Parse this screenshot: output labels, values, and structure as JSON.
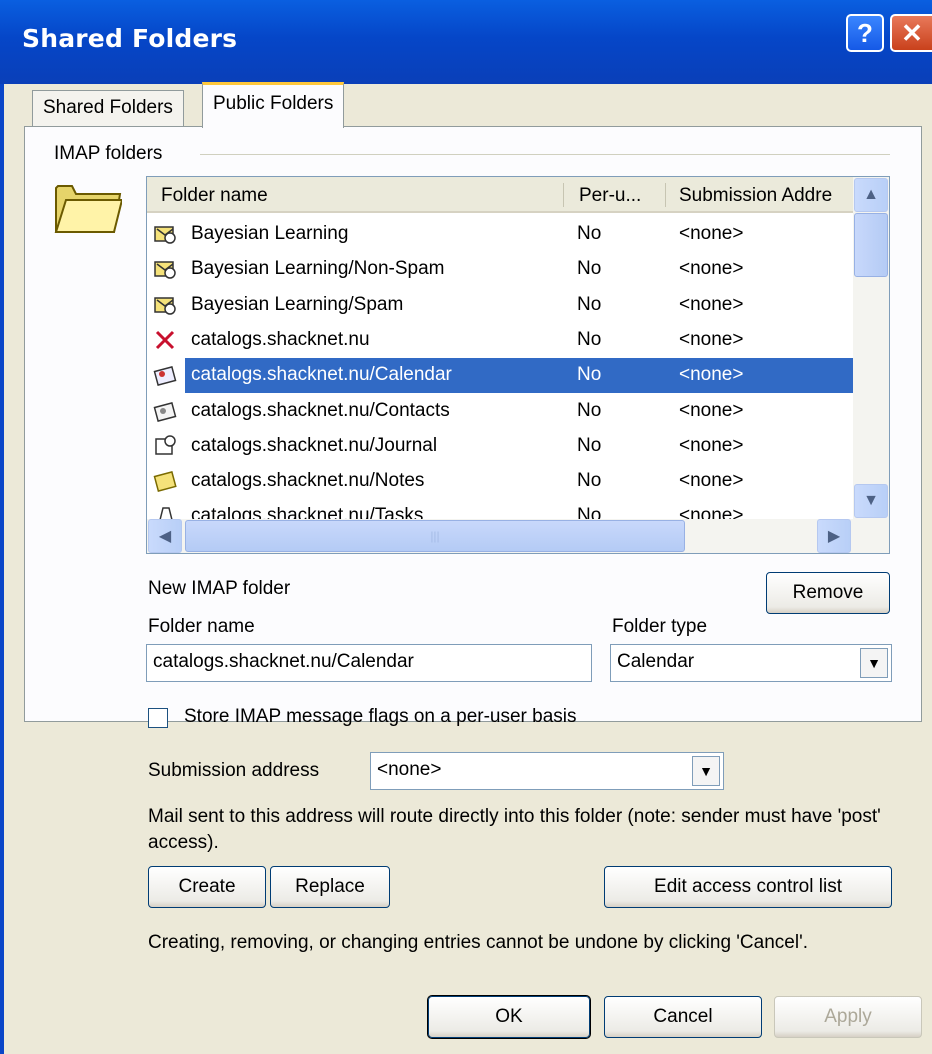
{
  "window": {
    "title": "Shared Folders",
    "help_glyph": "?",
    "close_glyph": "✕"
  },
  "tabs": [
    {
      "label": "Shared Folders",
      "selected": false
    },
    {
      "label": "Public Folders",
      "selected": true
    }
  ],
  "group": {
    "label": "IMAP folders"
  },
  "list": {
    "columns": [
      "Folder name",
      "Per-u...",
      "Submission Addre"
    ],
    "rows": [
      {
        "icon": "bayesian-icon",
        "name": "Bayesian Learning",
        "per_user": "No",
        "submission": "<none>",
        "selected": false
      },
      {
        "icon": "bayesian-icon",
        "name": "Bayesian Learning/Non-Spam",
        "per_user": "No",
        "submission": "<none>",
        "selected": false
      },
      {
        "icon": "bayesian-icon",
        "name": "Bayesian Learning/Spam",
        "per_user": "No",
        "submission": "<none>",
        "selected": false
      },
      {
        "icon": "red-x-icon",
        "name": "catalogs.shacknet.nu",
        "per_user": "No",
        "submission": "<none>",
        "selected": false
      },
      {
        "icon": "calendar-icon",
        "name": "catalogs.shacknet.nu/Calendar",
        "per_user": "No",
        "submission": "<none>",
        "selected": true
      },
      {
        "icon": "contacts-icon",
        "name": "catalogs.shacknet.nu/Contacts",
        "per_user": "No",
        "submission": "<none>",
        "selected": false
      },
      {
        "icon": "journal-icon",
        "name": "catalogs.shacknet.nu/Journal",
        "per_user": "No",
        "submission": "<none>",
        "selected": false
      },
      {
        "icon": "notes-icon",
        "name": "catalogs.shacknet.nu/Notes",
        "per_user": "No",
        "submission": "<none>",
        "selected": false
      },
      {
        "icon": "tasks-icon",
        "name": "catalogs.shacknet.nu/Tasks",
        "per_user": "No",
        "submission": "<none>",
        "selected": false
      }
    ]
  },
  "form": {
    "section_label": "New IMAP folder",
    "remove_label": "Remove",
    "folder_name_label": "Folder name",
    "folder_name_value": "catalogs.shacknet.nu/Calendar",
    "folder_type_label": "Folder type",
    "folder_type_value": "Calendar",
    "checkbox_label": "Store IMAP message flags on a per-user basis",
    "checkbox_checked": false,
    "submission_label": "Submission address",
    "submission_value": "<none>",
    "note": "Mail sent to this address will route directly into this folder (note: sender must have 'post' access).",
    "create_label": "Create",
    "replace_label": "Replace",
    "acl_label": "Edit access control list",
    "warning": "Creating, removing, or changing entries cannot be undone by clicking 'Cancel'."
  },
  "footer": {
    "ok_label": "OK",
    "cancel_label": "Cancel",
    "apply_label": "Apply"
  },
  "colors": {
    "titlebar": "#0a5fe0",
    "selection": "#316ac5",
    "face": "#ece9d8"
  }
}
